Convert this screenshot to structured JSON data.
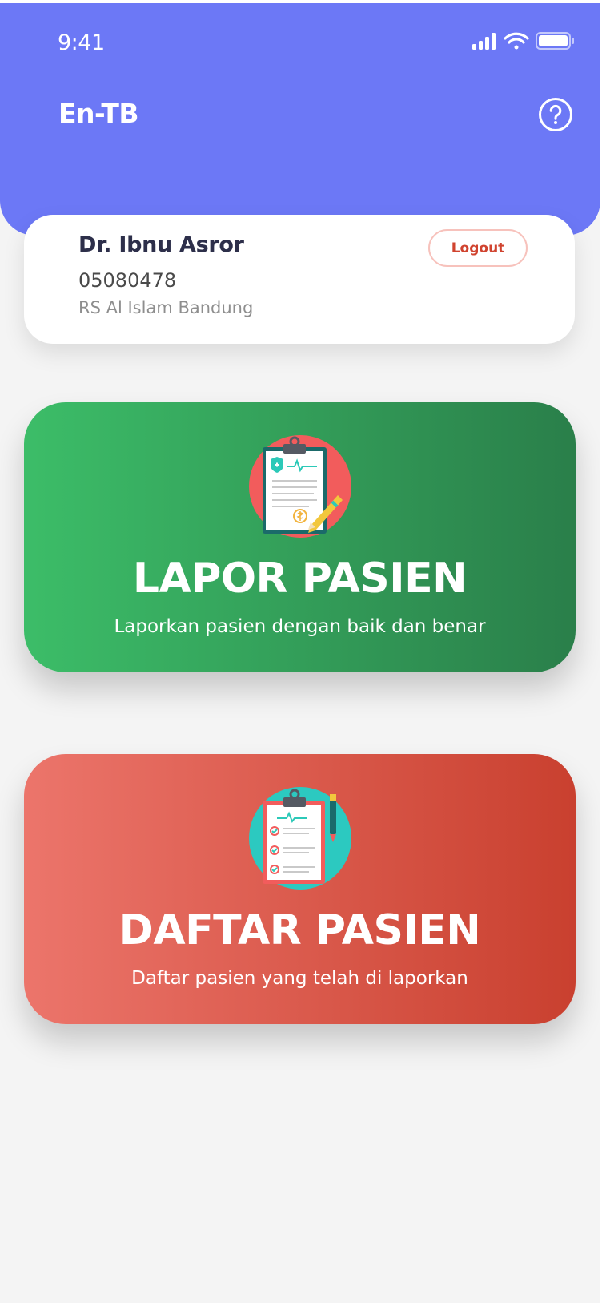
{
  "status_bar": {
    "time": "9:41"
  },
  "header": {
    "title": "En-TB",
    "help_icon": "question-circle-icon"
  },
  "profile": {
    "name": "Dr. Ibnu Asror",
    "id": "05080478",
    "hospital": "RS Al Islam Bandung",
    "logout_label": "Logout"
  },
  "menu": [
    {
      "title": "LAPOR PASIEN",
      "subtitle": "Laporkan pasien dengan baik dan benar",
      "icon": "clipboard-report-icon"
    },
    {
      "title": "DAFTAR PASIEN",
      "subtitle": "Daftar pasien yang telah di laporkan",
      "icon": "clipboard-checklist-icon"
    }
  ],
  "colors": {
    "header": "#6c78f6",
    "green_start": "#3cbd68",
    "green_end": "#2a7f4a",
    "red_start": "#ec756b",
    "red_end": "#c9402f",
    "logout_text": "#d0432f"
  }
}
